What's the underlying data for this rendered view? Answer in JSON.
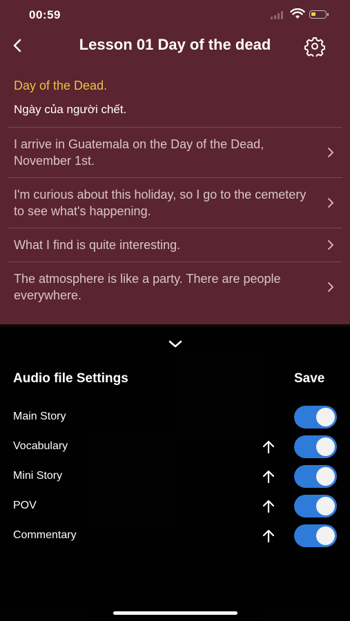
{
  "status_bar": {
    "time": "00:59"
  },
  "header": {
    "title": "Lesson 01 Day of the dead"
  },
  "highlight": {
    "title": "Day of the Dead.",
    "translation": "Ngày của người chết."
  },
  "sentences": [
    "I arrive in Guatemala on the Day of the Dead, November 1st.",
    "I'm curious about this holiday, so I go to the cemetery to see what's happening.",
    "What I find is quite interesting.",
    "The atmosphere is like a party. There are people everywhere."
  ],
  "panel": {
    "title": "Audio file Settings",
    "save_label": "Save",
    "options": [
      {
        "label": "Main Story",
        "enabled": true
      },
      {
        "label": "Vocabulary",
        "enabled": true
      },
      {
        "label": "Mini Story",
        "enabled": true
      },
      {
        "label": "POV",
        "enabled": true
      },
      {
        "label": "Commentary",
        "enabled": true
      }
    ]
  },
  "colors": {
    "background": "#5a2430",
    "highlight": "#e8c24a",
    "toggle_on": "#2f7bd9"
  }
}
